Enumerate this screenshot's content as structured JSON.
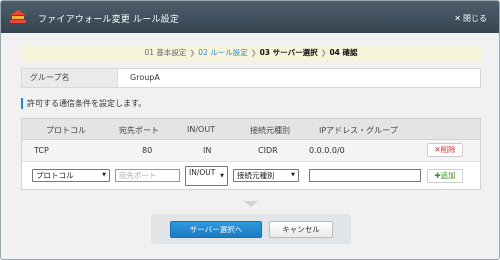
{
  "window": {
    "title": "ファイアウォール変更 ルール設定",
    "close_label": "閉じる"
  },
  "steps": [
    {
      "label": "01 基本設定",
      "state": "done"
    },
    {
      "label": "02 ルール設定",
      "state": "current"
    },
    {
      "label": "03 サーバー選択",
      "state": "upcoming"
    },
    {
      "label": "04 確認",
      "state": "upcoming"
    }
  ],
  "group": {
    "label": "グループ名",
    "value": "GroupA"
  },
  "section_title": "許可する通信条件を設定します。",
  "table": {
    "headers": {
      "protocol": "プロトコル",
      "dest_port": "宛先ポート",
      "in_out": "IN/OUT",
      "source_type": "接続元種別",
      "ip_group": "IPアドレス・グループ"
    },
    "rows": [
      {
        "protocol": "TCP",
        "dest_port": "80",
        "in_out": "IN",
        "source_type": "CIDR",
        "ip_group": "0.0.0.0/0",
        "delete_label": "削除"
      }
    ],
    "new_rule": {
      "protocol_select": "プロトコル",
      "dest_port_placeholder": "宛先ポート",
      "in_out_select": "IN/OUT",
      "source_type_select": "接続元種別",
      "ip_value": "",
      "add_label": "追加"
    }
  },
  "footer": {
    "next_label": "サーバー選択へ",
    "cancel_label": "キャンセル"
  },
  "colors": {
    "accent": "#2a86c8",
    "delete": "#d0312d",
    "add": "#3b8f1e",
    "titlebar": "#3d4c58"
  }
}
